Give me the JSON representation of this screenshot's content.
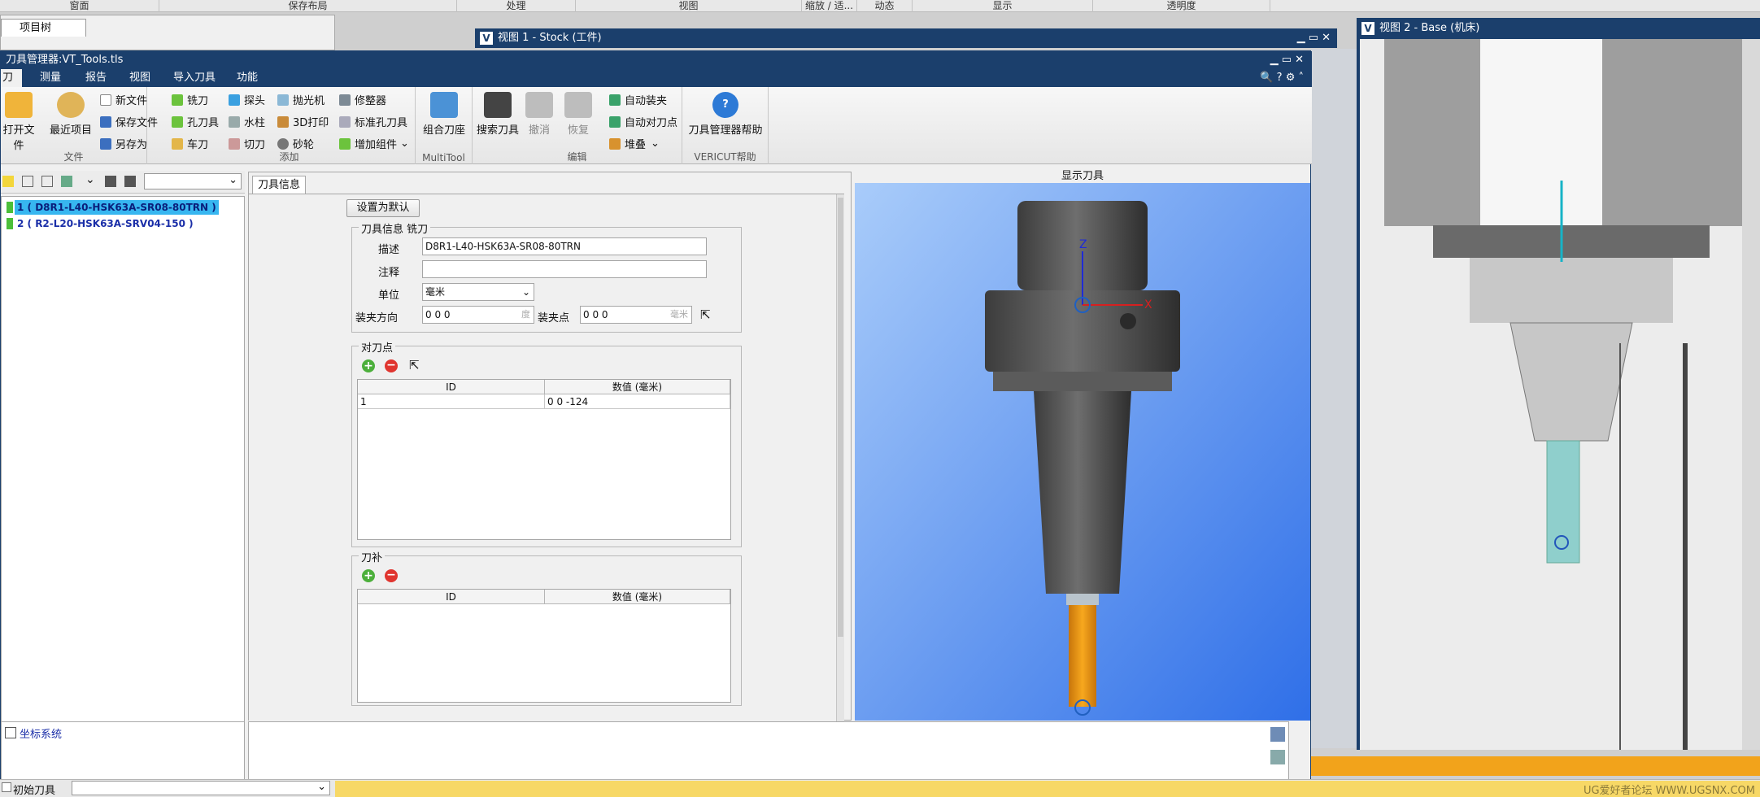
{
  "top_menu": [
    "窗面",
    "保存布局",
    "处理",
    "视图",
    "缩放 / 适...",
    "动态",
    "显示",
    "透明度"
  ],
  "project_tree": {
    "tab": "项目树"
  },
  "view1": {
    "title": "视图 1 - Stock (工件)"
  },
  "view2": {
    "title": "视图 2 - Base (机床)"
  },
  "tool_manager": {
    "title": "刀具管理器:VT_Tools.tls",
    "tabs": [
      "刀具",
      "测量",
      "报告",
      "视图",
      "导入刀具",
      "功能"
    ],
    "ribbon": {
      "file_group": {
        "label": "文件",
        "open": "打开文件",
        "recent": "最近项目",
        "new": "新文件",
        "save": "保存文件",
        "save_as": "另存为"
      },
      "add_group": {
        "label": "添加",
        "mill": "铣刀",
        "probe": "探头",
        "polish": "抛光机",
        "dresser": "修整器",
        "hole": "孔刀具",
        "waterjet": "水柱",
        "print3d": "3D打印",
        "std_hole": "标准孔刀具",
        "turn": "车刀",
        "cut": "切刀",
        "grind": "砂轮",
        "add_comp": "增加组件"
      },
      "multitool_group": {
        "label": "MultiTool",
        "combo": "组合刀座"
      },
      "edit_group": {
        "label": "编辑",
        "search": "搜索刀具",
        "undo": "撤消",
        "redo": "恢复",
        "auto_mount": "自动装夹",
        "auto_setpoint": "自动对刀点",
        "stack": "堆叠"
      },
      "help_group": {
        "label": "VERICUT帮助",
        "help": "刀具管理器帮助"
      }
    },
    "tool_list": [
      {
        "id": "1",
        "name": "1 ( D8R1-L40-HSK63A-SR08-80TRN )",
        "selected": true
      },
      {
        "id": "2",
        "name": "2 ( R2-L20-HSK63A-SRV04-150 )",
        "selected": false
      }
    ],
    "coord_system": "坐标系统",
    "initial_tool": "初始刀具"
  },
  "info_panel": {
    "tab": "刀具信息",
    "set_default": "设置为默认",
    "tool_info_legend": "刀具信息 铣刀",
    "desc_label": "描述",
    "desc_value": "D8R1-L40-HSK63A-SR08-80TRN",
    "comment_label": "注释",
    "comment_value": "",
    "unit_label": "单位",
    "unit_value": "毫米",
    "mount_dir_label": "装夹方向",
    "mount_dir_value": "0 0 0",
    "mount_dir_unit": "度",
    "mount_pt_label": "装夹点",
    "mount_pt_value": "0 0 0",
    "mount_pt_unit": "毫米",
    "setpoint_legend": "对刀点",
    "setpoint_cols": [
      "ID",
      "数值 (毫米)"
    ],
    "setpoint_rows": [
      [
        "1",
        "0 0 -124"
      ]
    ],
    "comp_legend": "刀补",
    "comp_cols": [
      "ID",
      "数值 (毫米)"
    ]
  },
  "display": {
    "caption": "显示刀具",
    "axis_z": "Z",
    "axis_x": "X"
  },
  "watermark": "UG爱好者论坛 WWW.UGSNX.COM",
  "colors": {
    "titlebar": "#1b3f6c",
    "selection": "#37b6f0",
    "tool_orange": "#f2a31b",
    "viewport_blue": "#4a86f5"
  }
}
